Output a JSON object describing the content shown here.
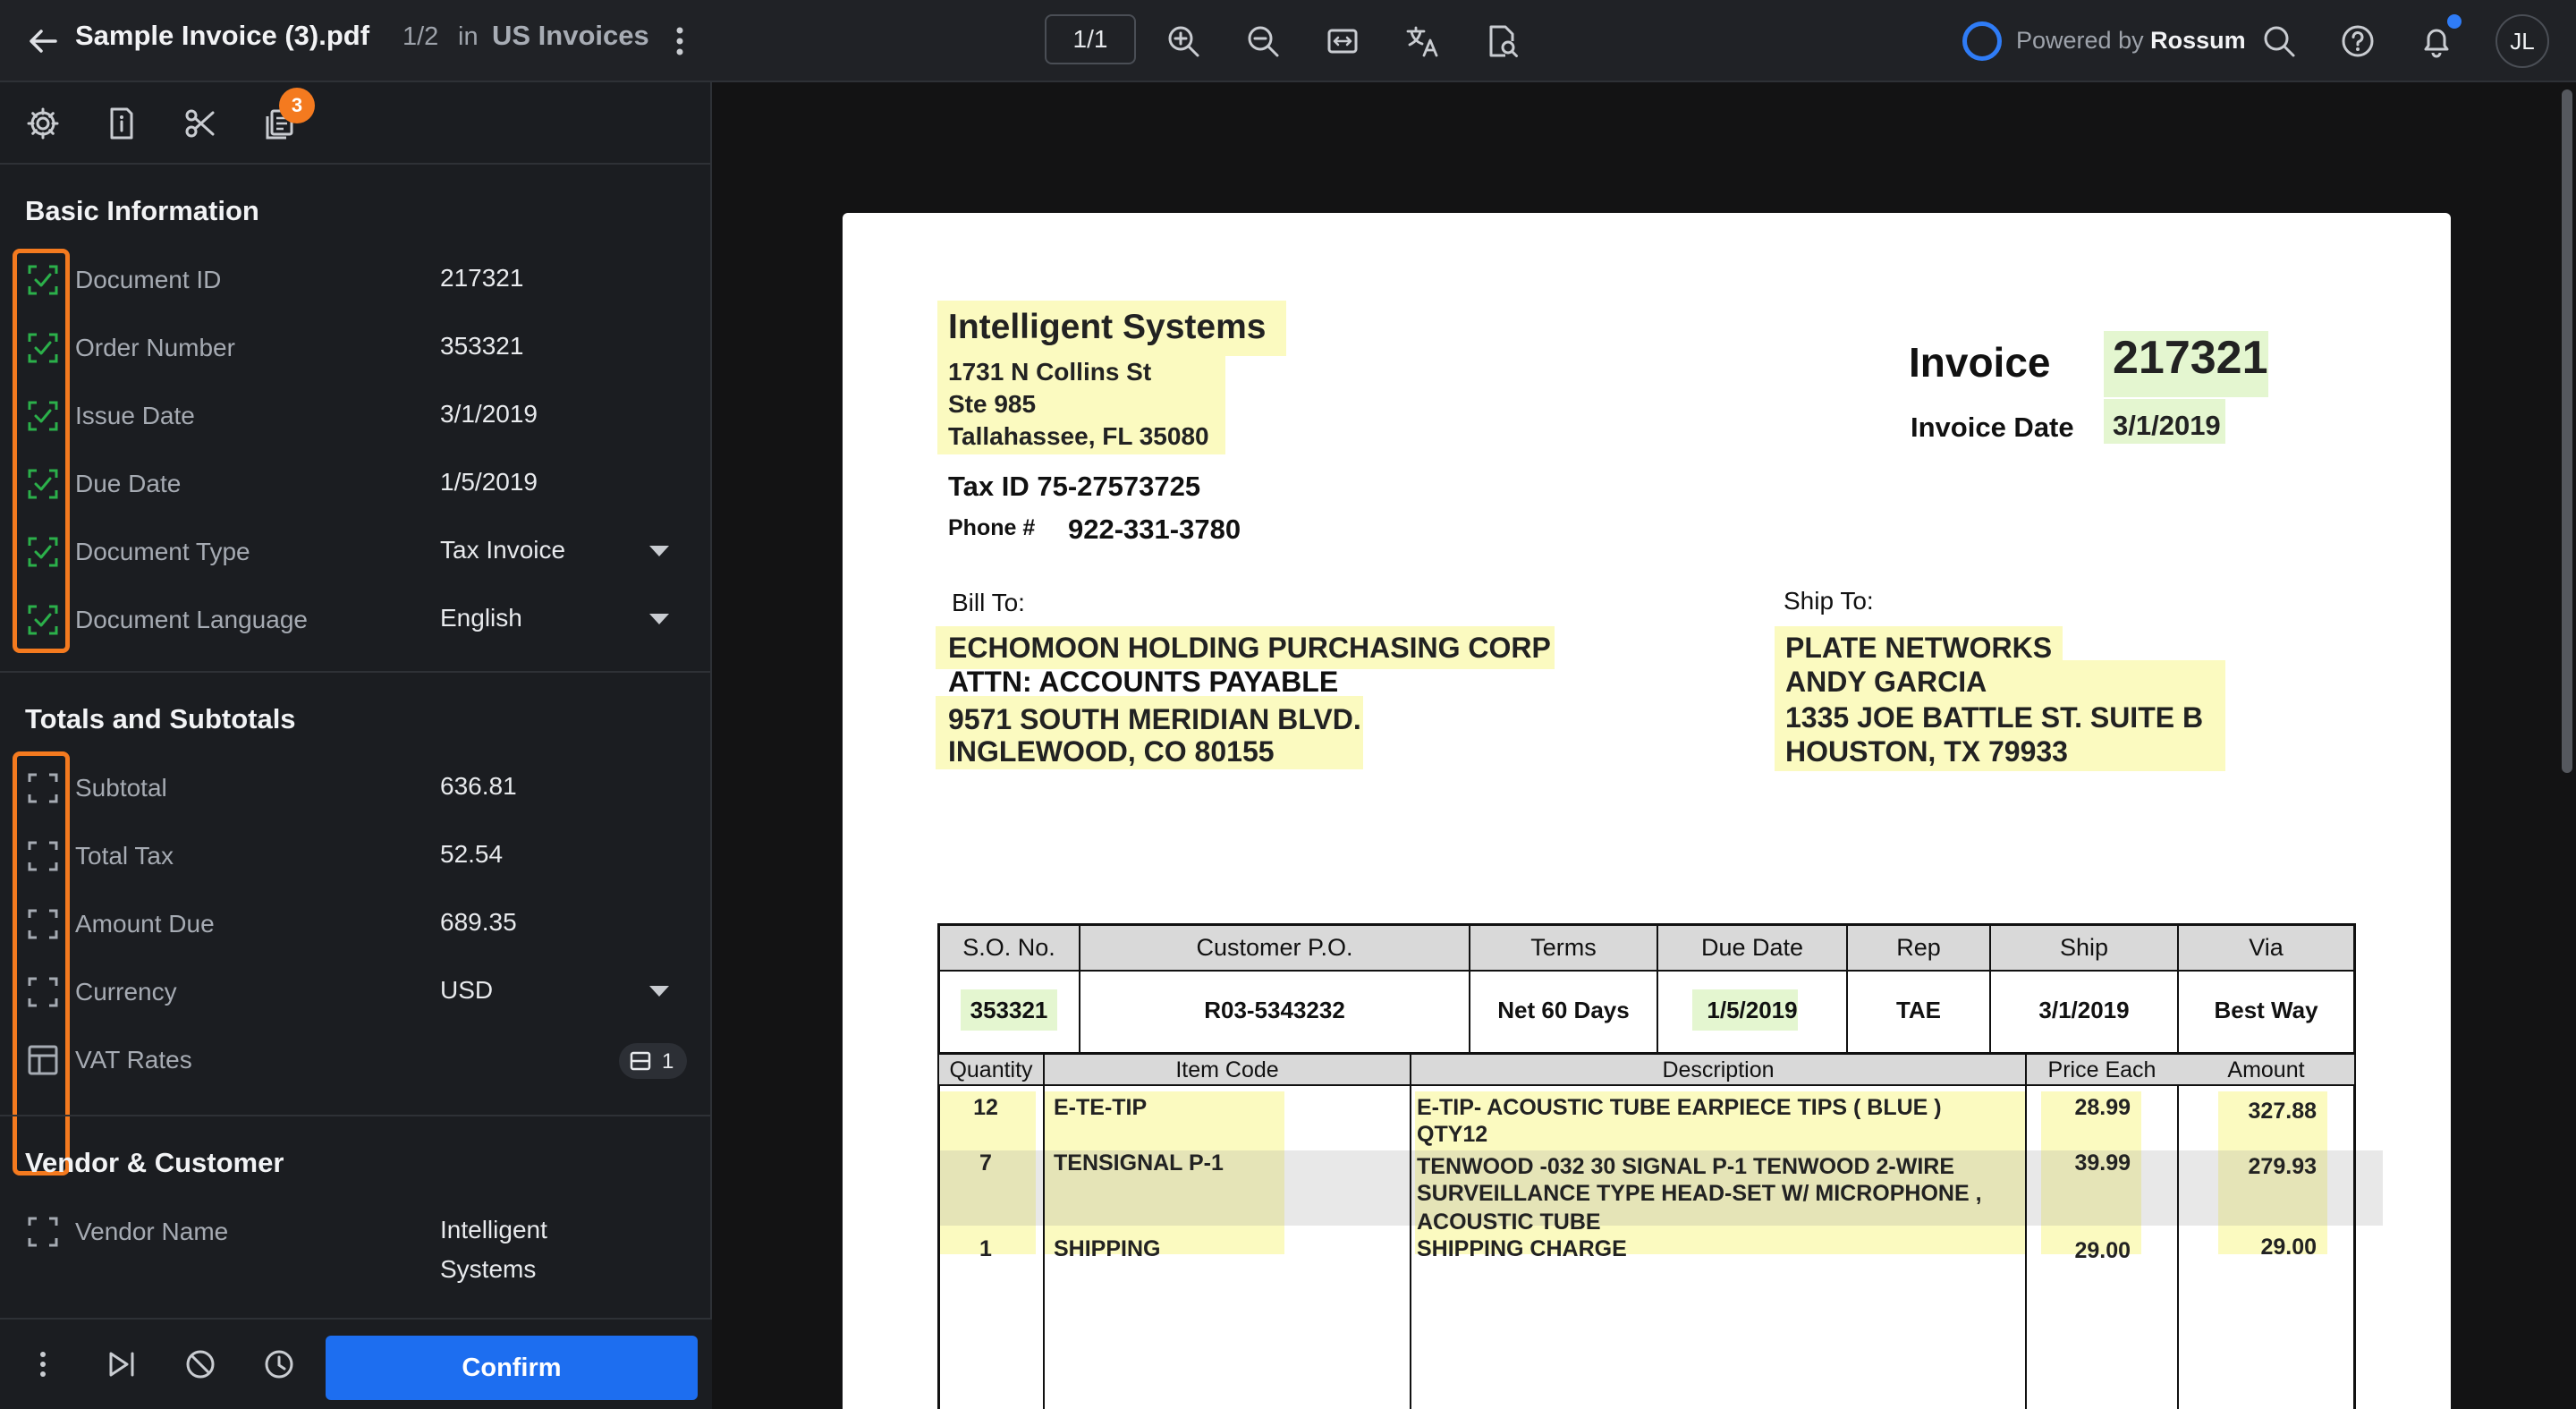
{
  "topbar": {
    "title": "Sample Invoice (3).pdf",
    "pager": "1/2",
    "in_label": "in",
    "queue": "US Invoices",
    "page_indicator": "1/1",
    "powered_by": "Powered by",
    "brand": "Rossum",
    "avatar_initials": "JL"
  },
  "side_tools": {
    "badge_count": "3"
  },
  "sections": {
    "basic": "Basic Information",
    "totals": "Totals and Subtotals",
    "vendor": "Vendor & Customer"
  },
  "basic_fields": [
    {
      "label": "Document ID",
      "value": "217321"
    },
    {
      "label": "Order Number",
      "value": "353321"
    },
    {
      "label": "Issue Date",
      "value": "3/1/2019"
    },
    {
      "label": "Due Date",
      "value": "1/5/2019"
    },
    {
      "label": "Document Type",
      "value": "Tax Invoice"
    },
    {
      "label": "Document Language",
      "value": "English"
    }
  ],
  "totals_fields": [
    {
      "label": "Subtotal",
      "value": "636.81"
    },
    {
      "label": "Total Tax",
      "value": "52.54"
    },
    {
      "label": "Amount Due",
      "value": "689.35"
    },
    {
      "label": "Currency",
      "value": "USD"
    },
    {
      "label": "VAT Rates",
      "value": "1"
    }
  ],
  "vendor_fields": [
    {
      "label": "Vendor Name",
      "value_line1": "Intelligent",
      "value_line2": "Systems"
    }
  ],
  "footer": {
    "confirm_label": "Confirm"
  },
  "colors": {
    "accent_blue": "#1d6ef0",
    "orange_highlight": "#f47a1f",
    "validated_green": "#2bb04a",
    "doc_highlight_yellow": "#fbfac0",
    "doc_highlight_green": "#e4f6d0"
  },
  "invoice": {
    "company": "Intelligent Systems",
    "addr1": "1731 N Collins St",
    "addr2": "Ste 985",
    "addr3": "Tallahassee, FL 35080",
    "tax_id": "Tax ID 75-27573725",
    "phone_label": "Phone #",
    "phone": "922-331-3780",
    "invoice_label": "Invoice",
    "invoice_number": "217321",
    "invoice_date_label": "Invoice Date",
    "invoice_date": "3/1/2019",
    "bill_to_label": "Bill To:",
    "bill_to": [
      "ECHOMOON HOLDING PURCHASING CORP",
      "ATTN: ACCOUNTS PAYABLE",
      "9571 SOUTH MERIDIAN BLVD.",
      "INGLEWOOD, CO 80155"
    ],
    "ship_to_label": "Ship To:",
    "ship_to": [
      "PLATE NETWORKS",
      "ANDY GARCIA",
      "1335 JOE BATTLE ST. SUITE B",
      "HOUSTON, TX 79933"
    ],
    "order_headers": [
      "S.O. No.",
      "Customer P.O.",
      "Terms",
      "Due Date",
      "Rep",
      "Ship",
      "Via"
    ],
    "order_values": [
      "353321",
      "R03-5343232",
      "Net 60 Days",
      "1/5/2019",
      "TAE",
      "3/1/2019",
      "Best Way"
    ],
    "item_headers": [
      "Quantity",
      "Item Code",
      "Description",
      "Price Each",
      "Amount"
    ],
    "items": [
      {
        "qty": "12",
        "code": "E-TE-TIP",
        "desc1": "E-TIP- ACOUSTIC TUBE EARPIECE TIPS ( BLUE )",
        "desc2": "QTY12",
        "desc3": "",
        "price": "28.99",
        "amount": "327.88"
      },
      {
        "qty": "7",
        "code": "TENSIGNAL P-1",
        "desc1": "TENWOOD -032 30  SIGNAL P-1 TENWOOD 2-WIRE",
        "desc2": "SURVEILLANCE TYPE HEAD-SET W/ MICROPHONE ,",
        "desc3": "ACOUSTIC TUBE",
        "price": "39.99",
        "amount": "279.93"
      },
      {
        "qty": "1",
        "code": "SHIPPING",
        "desc1": "SHIPPING CHARGE",
        "desc2": "",
        "desc3": "",
        "price": "29.00",
        "amount": "29.00"
      }
    ]
  }
}
